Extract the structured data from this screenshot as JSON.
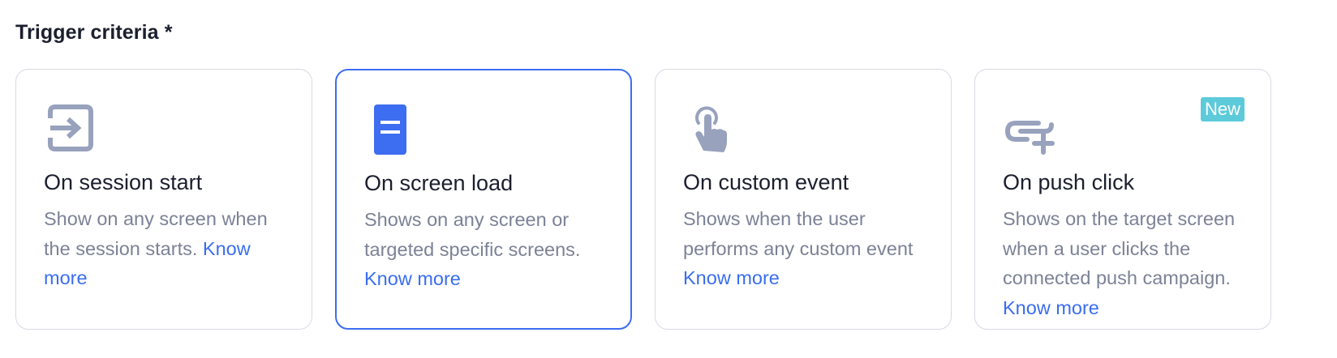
{
  "section": {
    "title": "Trigger criteria *"
  },
  "cards": [
    {
      "title": "On session start",
      "description": "Show on any screen when the session starts. ",
      "link": "Know more",
      "icon": "session-enter-icon",
      "selected": false
    },
    {
      "title": "On screen load",
      "description": "Shows on any screen or targeted specific screens. ",
      "link": "Know more",
      "icon": "screen-document-icon",
      "selected": true
    },
    {
      "title": "On custom event",
      "description": "Shows when the user performs any custom event ",
      "link": "Know more",
      "icon": "touch-hand-icon",
      "selected": false
    },
    {
      "title": "On push click",
      "description": "Shows on the target screen when a user clicks the connected push campaign. ",
      "link": "Know more",
      "icon": "push-link-icon",
      "badge": "New",
      "selected": false
    }
  ],
  "colors": {
    "accent": "#3d6df0",
    "icon_gray": "#98a2bd",
    "icon_blue": "#3d6df0",
    "badge": "#5ccad9",
    "border": "#d7dae3",
    "muted_text": "#7c8296"
  }
}
